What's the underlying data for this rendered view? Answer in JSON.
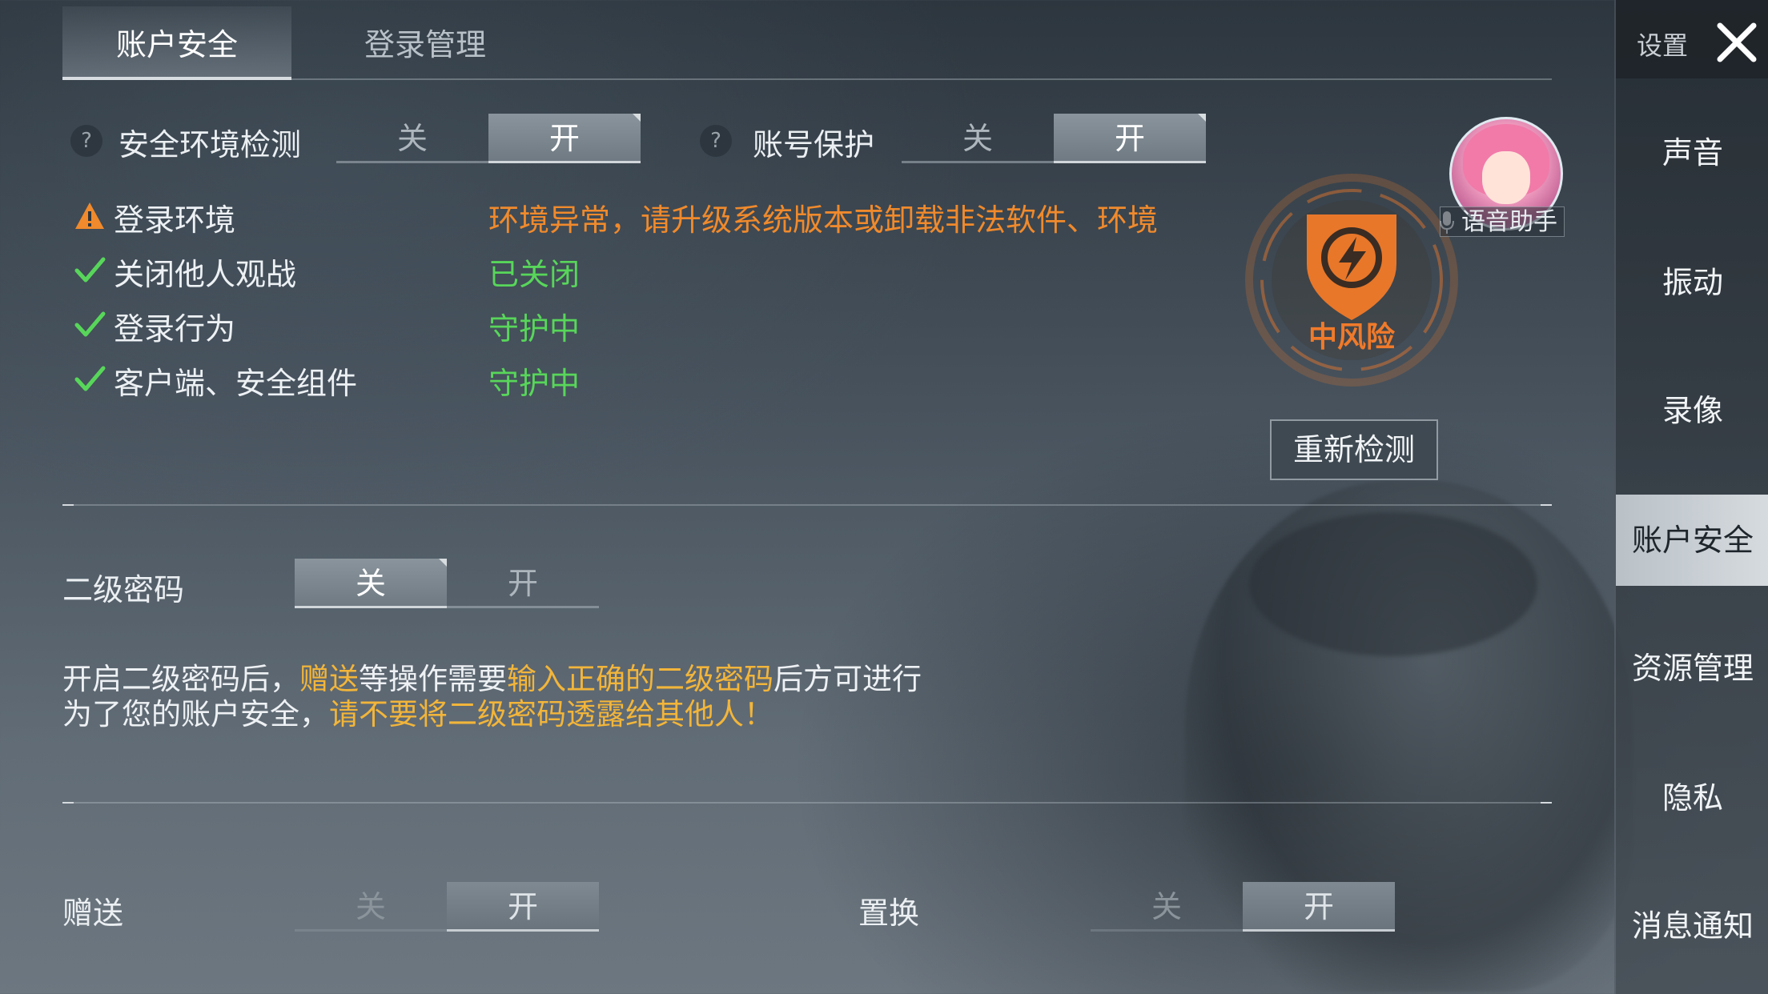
{
  "tabs": [
    {
      "label": "账户安全",
      "active": true
    },
    {
      "label": "登录管理",
      "active": false
    }
  ],
  "security_check": {
    "env_label": "安全环境检测",
    "env_toggle": {
      "off": "关",
      "on": "开",
      "state": "on"
    },
    "protect_label": "账号保护",
    "protect_toggle": {
      "off": "关",
      "on": "开",
      "state": "on"
    },
    "help_icon": "?"
  },
  "checks": [
    {
      "label": "登录环境",
      "status": "环境异常，请升级系统版本或卸载非法软件、环境",
      "icon": "warning-icon",
      "color": "#f08a2c"
    },
    {
      "label": "关闭他人观战",
      "status": "已关闭",
      "icon": "check-icon",
      "color": "#58d65a"
    },
    {
      "label": "登录行为",
      "status": "守护中",
      "icon": "check-icon",
      "color": "#58d65a"
    },
    {
      "label": "客户端、安全组件",
      "status": "守护中",
      "icon": "check-icon",
      "color": "#58d65a"
    }
  ],
  "risk": {
    "label": "中风险",
    "color": "#f07a2a"
  },
  "voice_assistant": {
    "label": "语音助手"
  },
  "recheck_button": "重新检测",
  "secondary_password": {
    "label": "二级密码",
    "toggle": {
      "off": "关",
      "on": "开",
      "state": "off"
    },
    "notice_line1": {
      "p1": "开启二级密码后，",
      "h1": "赠送",
      "p2": "等操作需要",
      "h2": "输入正确的二级密码",
      "p3": "后方可进行"
    },
    "notice_line2": {
      "p1": "为了您的账户安全，",
      "h1": "请不要将二级密码透露给其他人！"
    }
  },
  "gift": {
    "label": "赠送",
    "toggle": {
      "off": "关",
      "on": "开",
      "state": "on"
    }
  },
  "exchange": {
    "label": "置换",
    "toggle": {
      "off": "关",
      "on": "开",
      "state": "on"
    }
  },
  "sidebar": {
    "title": "设置",
    "items": [
      {
        "label": "声音",
        "active": false
      },
      {
        "label": "振动",
        "active": false
      },
      {
        "label": "录像",
        "active": false
      },
      {
        "label": "账户安全",
        "active": true
      },
      {
        "label": "资源管理",
        "active": false
      },
      {
        "label": "隐私",
        "active": false
      },
      {
        "label": "消息通知",
        "active": false
      }
    ]
  }
}
